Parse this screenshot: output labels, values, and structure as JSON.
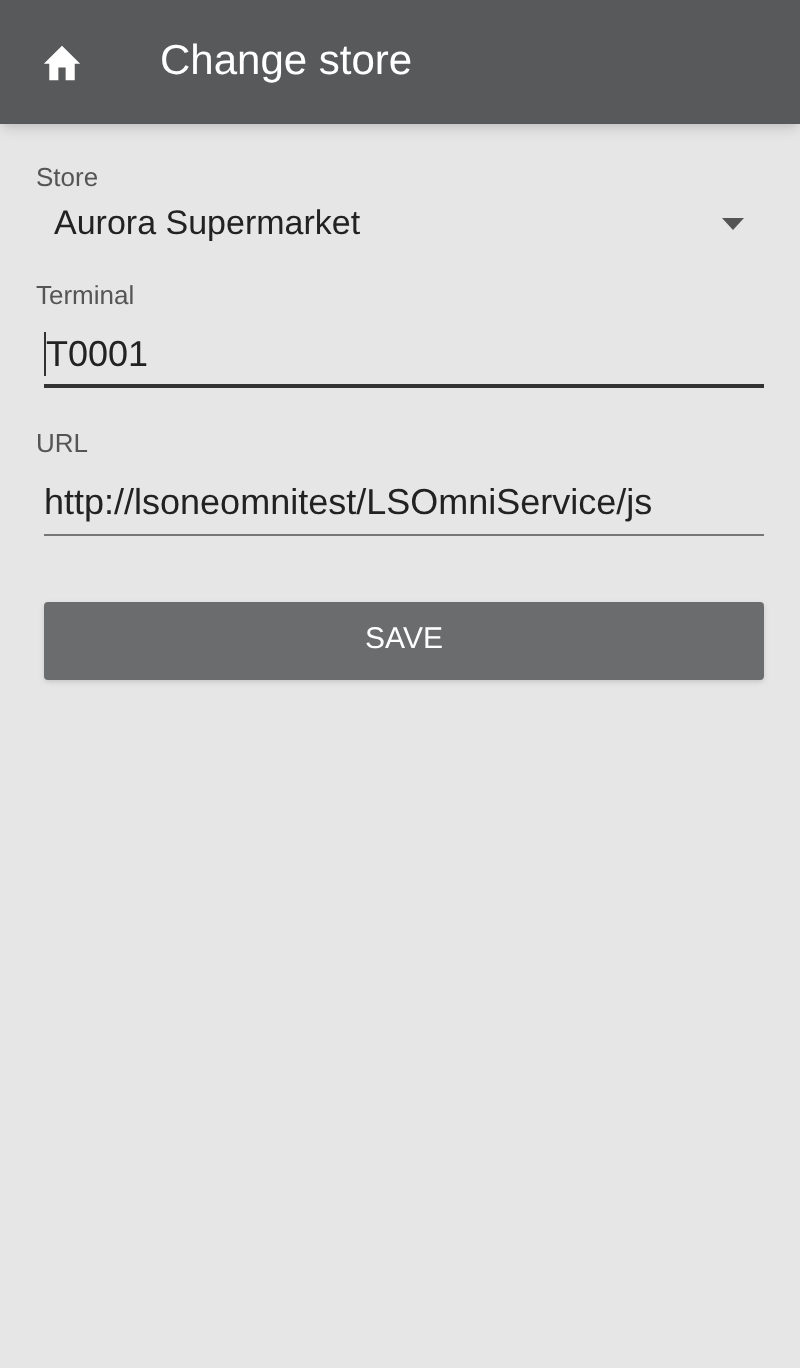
{
  "app_bar": {
    "title": "Change store"
  },
  "store": {
    "label": "Store",
    "value": "Aurora Supermarket"
  },
  "fields": [
    {
      "label": "Terminal",
      "value": "T0001",
      "focused": true
    },
    {
      "label": "URL",
      "value": "http://lsoneomnitest/LSOmniService/js",
      "focused": false
    }
  ],
  "save_button": "SAVE"
}
